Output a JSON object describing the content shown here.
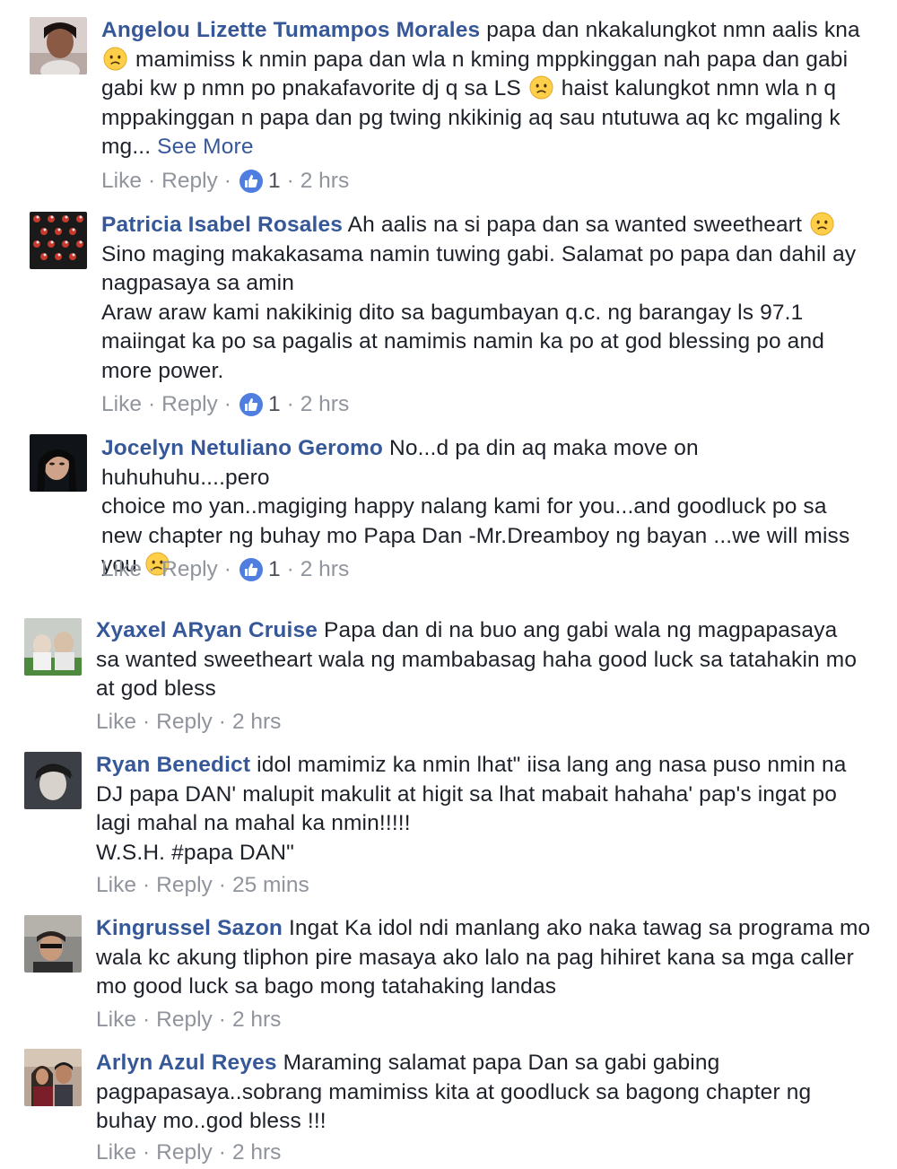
{
  "actions": {
    "like": "Like",
    "reply": "Reply",
    "sep": "·"
  },
  "comments": [
    {
      "author": "Angelou Lizette Tumampos Morales",
      "lines": [
        " papa dan nkakalungkot nmn aalis kna",
        " mamimiss k nmin papa dan wla n kming mppkinggan nah papa dan gabi",
        "gabi kw p nmn po pnakafavorite dj q sa LS ",
        " haist kalungkot nmn wla n q",
        "mppakinggan n papa dan pg twing nkikinig aq sau ntutuwa aq kc mgaling k",
        "mg... "
      ],
      "see_more": "See More",
      "reactions": "1",
      "time": "2 hrs"
    },
    {
      "author": "Patricia Isabel Rosales",
      "lines": [
        " Ah aalis na si papa dan sa wanted sweetheart ",
        "Sino maging makakasama namin tuwing gabi. Salamat po papa dan dahil ay",
        "nagpasaya sa amin",
        "Araw araw kami nakikinig dito sa bagumbayan q.c. ng barangay ls 97.1",
        "maiingat ka po sa pagalis at namimis namin ka po at god blessing po and",
        "more power."
      ],
      "reactions": "1",
      "time": "2 hrs"
    },
    {
      "author": "Jocelyn Netuliano Geromo",
      "lines": [
        " No...d pa din aq maka move on huhuhuhu....pero",
        "choice mo yan..magiging happy nalang kami for you...and goodluck po sa",
        "new chapter ng buhay mo Papa Dan -Mr.Dreamboy ng bayan ...we will miss",
        "you "
      ],
      "reactions": "1",
      "time": "2 hrs"
    },
    {
      "author": "Xyaxel ARyan Cruise",
      "lines": [
        " Papa dan di na buo ang gabi wala ng magpapasaya",
        "sa wanted sweetheart wala ng mambabasag haha good luck sa tatahakin mo",
        "at god bless"
      ],
      "time": "2 hrs"
    },
    {
      "author": "Ryan Benedict",
      "lines": [
        " idol mamimiz ka nmin lhat\" iisa lang ang nasa puso nmin na",
        "DJ papa DAN' malupit makulit at higit sa lhat mabait hahaha' pap's ingat po",
        "lagi mahal na mahal ka nmin!!!!!",
        "W.S.H. #papa DAN\""
      ],
      "time": "25 mins"
    },
    {
      "author": "Kingrussel Sazon",
      "lines": [
        " Ingat Ka idol ndi manlang ako naka tawag sa programa mo",
        "wala kc akung tliphon pire masaya ako lalo na pag hihiret kana sa mga caller",
        "mo good luck sa bago mong tatahaking landas"
      ],
      "time": "2 hrs"
    },
    {
      "author": "Arlyn Azul Reyes",
      "lines": [
        " Maraming salamat papa Dan sa gabi gabing",
        "pagpapasaya..sobrang mamimiss kita at goodluck sa bagong chapter ng",
        "buhay mo..god bless !!!"
      ],
      "time": "2 hrs"
    }
  ]
}
